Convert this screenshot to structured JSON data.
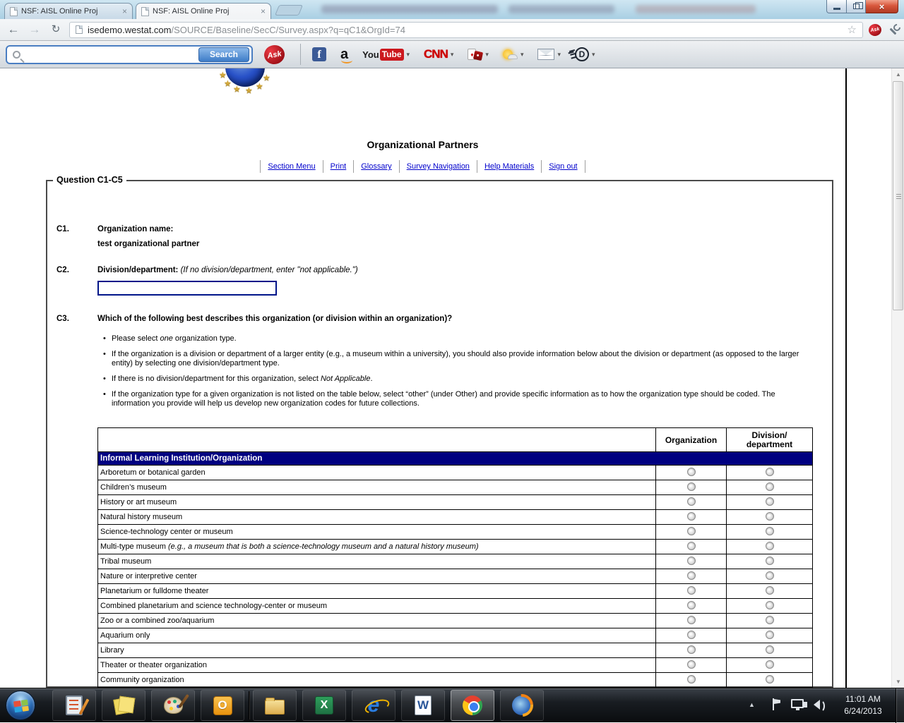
{
  "colors": {
    "accent_navy": "#000080",
    "link_blue": "#0000cc",
    "close_button_red": "#b03a22",
    "section_band_bg": "#000080"
  },
  "icons": {
    "back": "←",
    "forward": "→",
    "reload": "↻",
    "star": "☆",
    "tab_close": "×",
    "close_x": "×",
    "caret": "▾",
    "bullet": "•",
    "scroll_up": "▲",
    "scroll_down": "▼",
    "tray_arrow": "▲",
    "gold_star": "★",
    "card_suit": "♦",
    "facebook_letter": "f",
    "amazon_letter": "a",
    "youtube_part1": "You",
    "youtube_part2": "Tube",
    "cnn_label": "CNN",
    "d_letter": "D",
    "outlook_letter": "O",
    "excel_letter": "X",
    "word_letter": "W",
    "ie_letter": "e"
  },
  "browser": {
    "tabs": [
      {
        "title": "NSF: AISL Online Proj"
      },
      {
        "title": "NSF: AISL Online Proj"
      }
    ],
    "address": {
      "host": "isedemo.westat.com",
      "path": "/SOURCE/Baseline/SecC/Survey.aspx?q=qC1&OrgId=74"
    }
  },
  "ask_toolbar": {
    "search_value": "",
    "search_placeholder": "",
    "search_button_label": "Search",
    "ask_label": "Ask"
  },
  "page": {
    "nav": [
      "Section Menu",
      "Print",
      "Glossary",
      "Survey Navigation",
      "Help Materials",
      "Sign out"
    ],
    "title": "Organizational Partners",
    "legend": "Question C1-C5",
    "q1": {
      "no": "C1.",
      "label": "Organization name:",
      "value": "test organizational partner"
    },
    "q2": {
      "no": "C2.",
      "label": "Division/department: ",
      "hint": "(If no division/department, enter \"not applicable.\")",
      "value": ""
    },
    "q3": {
      "no": "C3.",
      "label": "Which of the following best describes this organization (or division within an organization)?",
      "bullets": [
        {
          "pre": "Please select ",
          "it": "one",
          "post": " organization type."
        },
        {
          "pre": "If the organization is a division or department of a larger entity (e.g., a museum within a university), you should also provide information below about the division or department (as opposed to the larger entity) by selecting one division/department type.",
          "it": "",
          "post": ""
        },
        {
          "pre": "If there is no division/department for this organization, select ",
          "it": "Not Applicable",
          "post": "."
        },
        {
          "pre": "If the organization type for a given organization is not listed on the table below, select “other” (under Other) and provide specific information as to how the organization type should be coded. The information you provide will help us develop new organization codes for future collections.",
          "it": "",
          "post": ""
        }
      ]
    },
    "table": {
      "col_org": "Organization",
      "col_div1": "Division/",
      "col_div2": "department",
      "section": "Informal Learning Institution/Organization",
      "rows": [
        {
          "label": "Arboretum or botanical garden",
          "note": ""
        },
        {
          "label": "Children’s museum",
          "note": ""
        },
        {
          "label": "History or art museum",
          "note": ""
        },
        {
          "label": "Natural history museum",
          "note": ""
        },
        {
          "label": "Science-technology center or museum",
          "note": ""
        },
        {
          "label": "Multi-type museum ",
          "note": "(e.g., a museum that is both a science-technology museum and a natural history museum)"
        },
        {
          "label": "Tribal museum",
          "note": ""
        },
        {
          "label": "Nature or interpretive center",
          "note": ""
        },
        {
          "label": "Planetarium or fulldome theater",
          "note": ""
        },
        {
          "label": "Combined planetarium and science technology-center or museum",
          "note": ""
        },
        {
          "label": "Zoo or a combined zoo/aquarium",
          "note": ""
        },
        {
          "label": "Aquarium only",
          "note": ""
        },
        {
          "label": "Library",
          "note": ""
        },
        {
          "label": "Theater or theater organization",
          "note": ""
        },
        {
          "label": "Community organization",
          "note": ""
        }
      ]
    }
  },
  "taskbar": {
    "time": "11:01 AM",
    "date": "6/24/2013"
  }
}
